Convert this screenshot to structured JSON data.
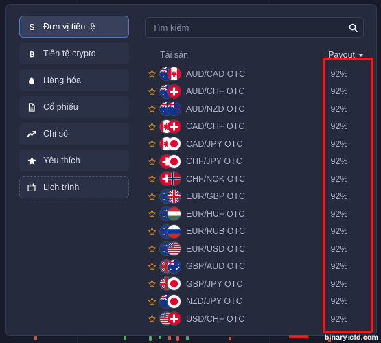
{
  "sidebar": {
    "items": [
      {
        "label": "Đơn vị tiền tệ",
        "icon": "dollar-icon",
        "state": "active"
      },
      {
        "label": "Tiền tệ crypto",
        "icon": "bitcoin-icon",
        "state": "normal"
      },
      {
        "label": "Hàng hóa",
        "icon": "droplet-icon",
        "state": "normal"
      },
      {
        "label": "Cổ phiếu",
        "icon": "document-icon",
        "state": "normal"
      },
      {
        "label": "Chỉ số",
        "icon": "trending-up-icon",
        "state": "normal"
      },
      {
        "label": "Yêu thích",
        "icon": "star-icon",
        "state": "normal"
      },
      {
        "label": "Lịch trình",
        "icon": "calendar-icon",
        "state": "dashed"
      }
    ]
  },
  "search": {
    "placeholder": "Tìm kiếm",
    "value": "",
    "icon": "search-icon"
  },
  "list_header": {
    "asset_label": "Tài sản",
    "payout_label": "Payout",
    "sort_icon": "chevron-down-icon"
  },
  "assets": [
    {
      "pair": "AUD/CAD OTC",
      "payout": "92%",
      "flag1": "au",
      "flag2": "ca",
      "favorite": false
    },
    {
      "pair": "AUD/CHF OTC",
      "payout": "92%",
      "flag1": "au",
      "flag2": "ch",
      "favorite": false
    },
    {
      "pair": "AUD/NZD OTC",
      "payout": "92%",
      "flag1": "au",
      "flag2": "nz",
      "favorite": false
    },
    {
      "pair": "CAD/CHF OTC",
      "payout": "92%",
      "flag1": "ca",
      "flag2": "ch",
      "favorite": false
    },
    {
      "pair": "CAD/JPY OTC",
      "payout": "92%",
      "flag1": "ca",
      "flag2": "jp",
      "favorite": false
    },
    {
      "pair": "CHF/JPY OTC",
      "payout": "92%",
      "flag1": "ch",
      "flag2": "jp",
      "favorite": false
    },
    {
      "pair": "CHF/NOK OTC",
      "payout": "92%",
      "flag1": "ch",
      "flag2": "no",
      "favorite": false
    },
    {
      "pair": "EUR/GBP OTC",
      "payout": "92%",
      "flag1": "eu",
      "flag2": "gb",
      "favorite": false
    },
    {
      "pair": "EUR/HUF OTC",
      "payout": "92%",
      "flag1": "eu",
      "flag2": "hu",
      "favorite": false
    },
    {
      "pair": "EUR/RUB OTC",
      "payout": "92%",
      "flag1": "eu",
      "flag2": "ru",
      "favorite": false
    },
    {
      "pair": "EUR/USD OTC",
      "payout": "92%",
      "flag1": "eu",
      "flag2": "us",
      "favorite": false
    },
    {
      "pair": "GBP/AUD OTC",
      "payout": "92%",
      "flag1": "gb",
      "flag2": "au",
      "favorite": false
    },
    {
      "pair": "GBP/JPY OTC",
      "payout": "92%",
      "flag1": "gb",
      "flag2": "jp",
      "favorite": false
    },
    {
      "pair": "NZD/JPY OTC",
      "payout": "92%",
      "flag1": "nz",
      "flag2": "jp",
      "favorite": false
    },
    {
      "pair": "USD/CHF OTC",
      "payout": "92%",
      "flag1": "us",
      "flag2": "ch",
      "favorite": false
    }
  ],
  "annotation": {
    "highlight_color": "#ee1b1b",
    "target": "payout-column"
  },
  "watermark": {
    "text": "binary-cfd.com"
  },
  "colors": {
    "panel_bg": "#252a3d",
    "nav_bg": "#2b3147",
    "nav_active_bg": "#39405c",
    "nav_active_border": "#4b74c4",
    "text_primary": "#d5dae8",
    "text_muted": "#a9b1c6",
    "star": "#c8872e",
    "accent_red": "#ee1b1b"
  }
}
